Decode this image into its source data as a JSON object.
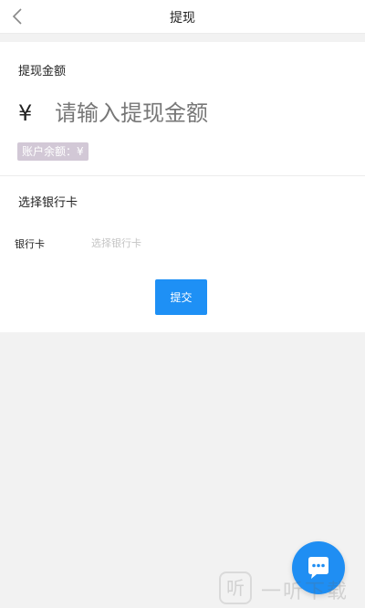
{
  "header": {
    "title": "提现",
    "back_icon": "chevron-left-icon"
  },
  "withdraw": {
    "amount_label": "提现金额",
    "currency_symbol": "¥",
    "amount_placeholder": "请输入提现金额",
    "amount_value": "",
    "balance_text": "账户余额：¥"
  },
  "bank": {
    "section_label": "选择银行卡",
    "row_label": "银行卡",
    "select_placeholder": "选择银行卡",
    "select_value": ""
  },
  "submit_label": "提交",
  "chat_fab_icon": "chat-bubble-icon",
  "watermark": {
    "icon_glyph": "听",
    "text": "一听下载"
  },
  "colors": {
    "accent": "#1e90f5",
    "balance_badge": "#d2c8d6",
    "page_bg": "#f2f2f2"
  }
}
